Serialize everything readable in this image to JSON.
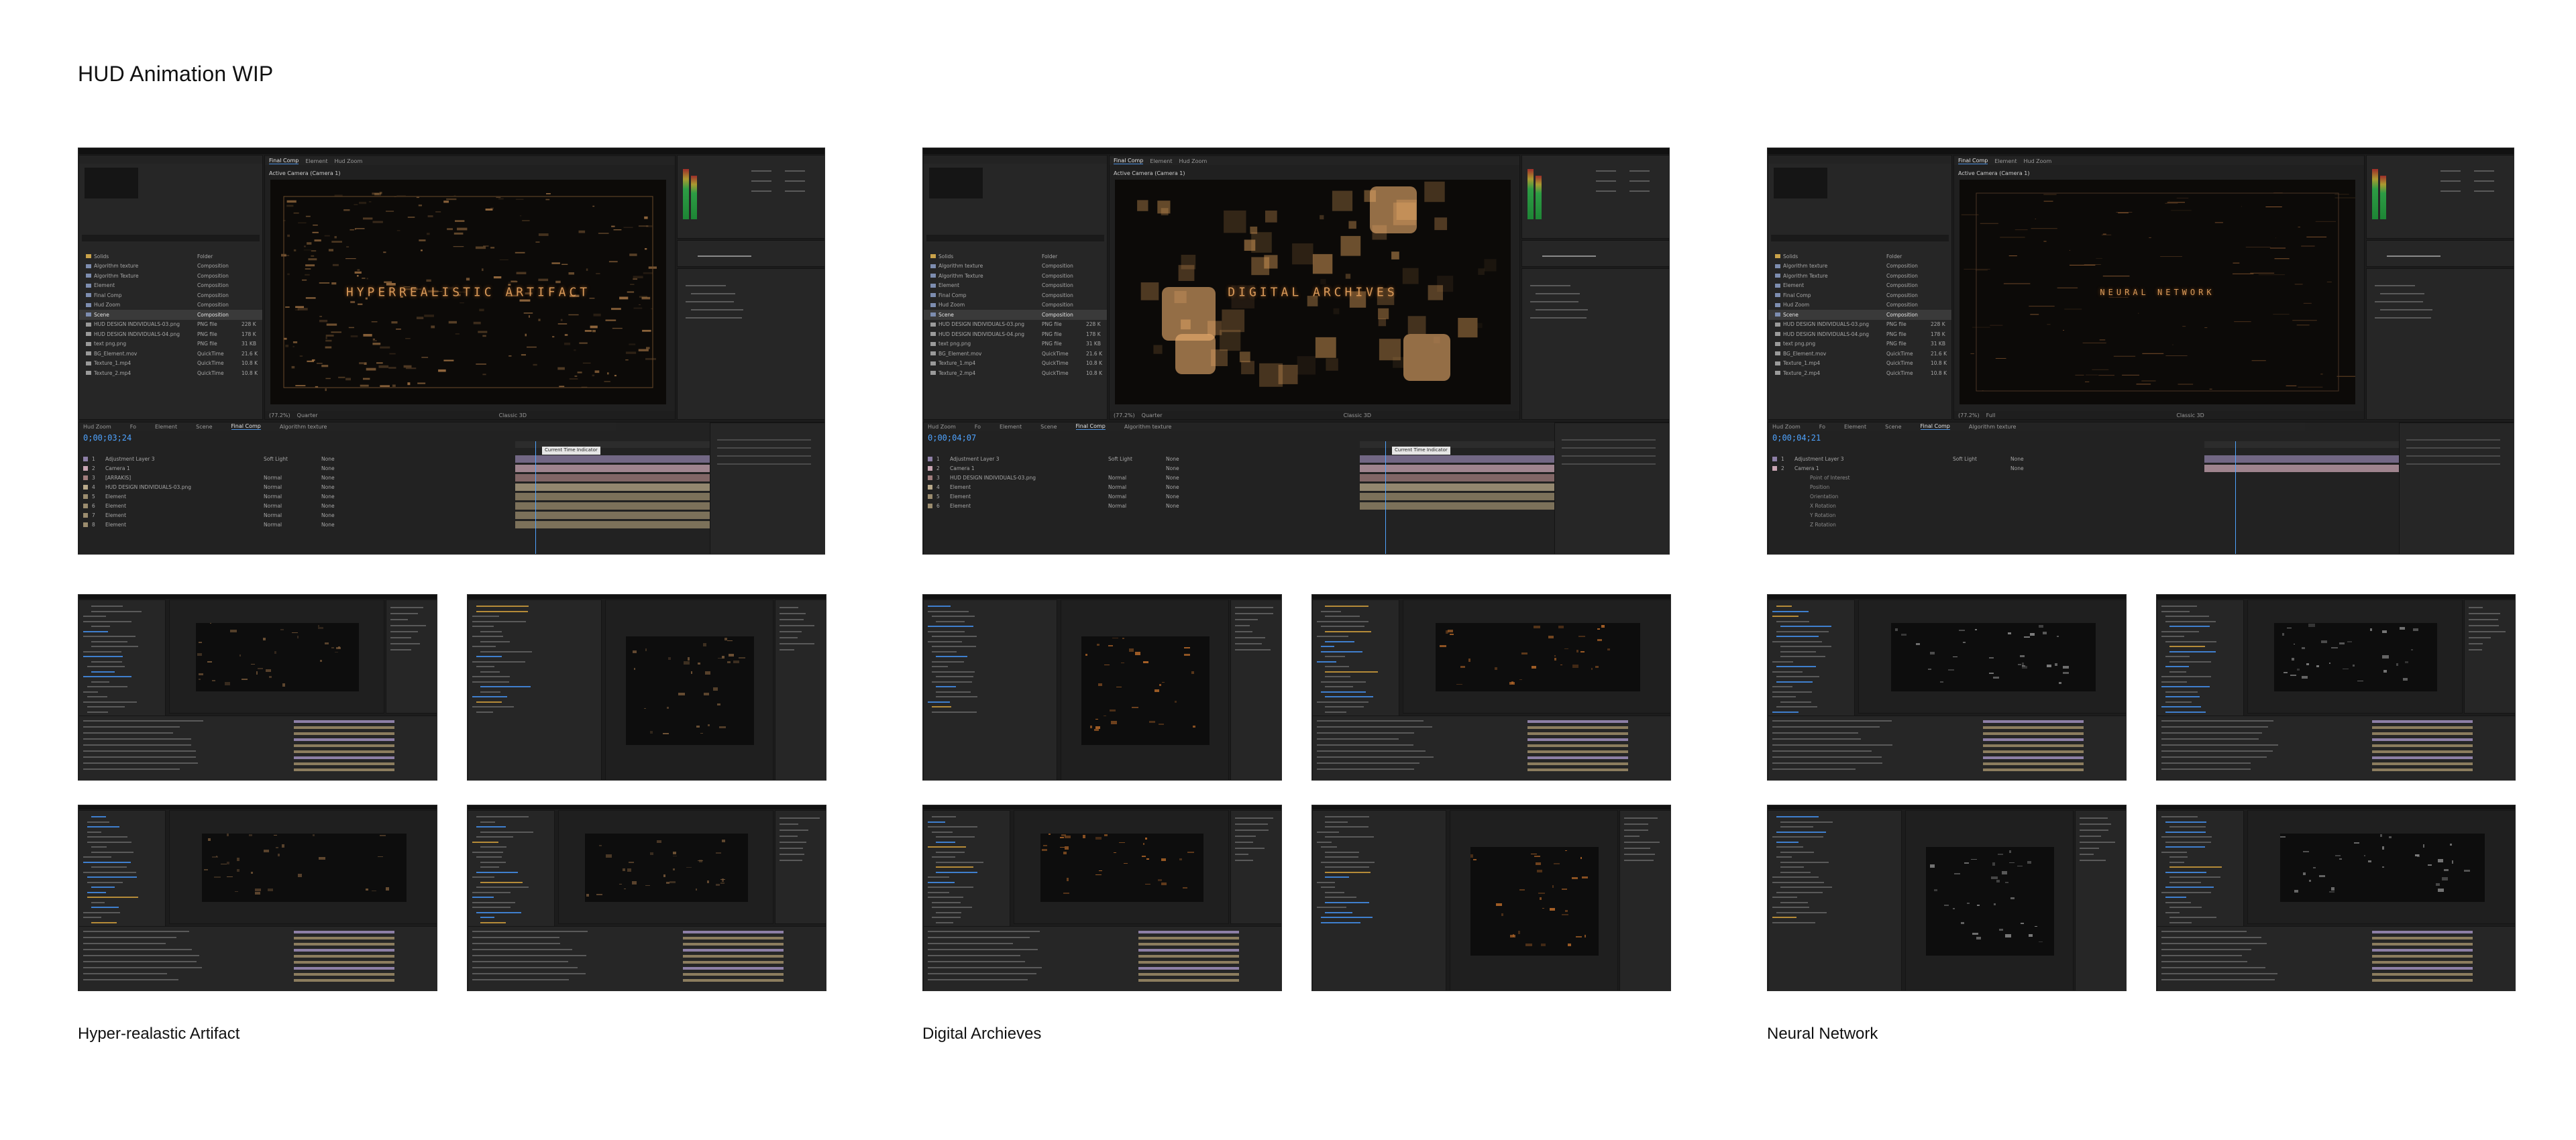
{
  "page": {
    "title": "HUD Animation WIP"
  },
  "projects": [
    {
      "caption": "Hyper-realastic Artifact",
      "composition_tabs": [
        "Final Comp",
        "Element",
        "Hud Zoom"
      ],
      "viewer_label": "Active Camera (Camera 1)",
      "comp_title": "HYPERREALISTIC ARTIFACT",
      "timecode": "0;00;03;24",
      "zoom": "(77.2%)",
      "resolution": "Quarter",
      "renderer": "Classic 3D",
      "project_items": [
        {
          "name": "Solids",
          "type": "Folder",
          "size": ""
        },
        {
          "name": "Algorithm texture",
          "type": "Composition",
          "size": ""
        },
        {
          "name": "Algorithm Texture",
          "type": "Composition",
          "size": ""
        },
        {
          "name": "Element",
          "type": "Composition",
          "size": ""
        },
        {
          "name": "Final Comp",
          "type": "Composition",
          "size": ""
        },
        {
          "name": "Hud Zoom",
          "type": "Composition",
          "size": ""
        },
        {
          "name": "Scene",
          "type": "Composition",
          "size": ""
        },
        {
          "name": "HUD DESIGN INDIVIDUALS-03.png",
          "type": "PNG file",
          "size": "228 K"
        },
        {
          "name": "HUD DESIGN INDIVIDUALS-04.png",
          "type": "PNG file",
          "size": "178 K"
        },
        {
          "name": "text png.png",
          "type": "PNG file",
          "size": "31 KB"
        },
        {
          "name": "BG_Element.mov",
          "type": "QuickTime",
          "size": "21.6 K"
        },
        {
          "name": "Texture_1.mp4",
          "type": "QuickTime",
          "size": "10.8 K"
        },
        {
          "name": "Texture_2.mp4",
          "type": "QuickTime",
          "size": "10.8 K"
        }
      ],
      "timeline_tabs": [
        "Hud Zoom",
        "Fo",
        "Element",
        "Scene",
        "Final Comp",
        "Algorithm texture"
      ],
      "layers": [
        {
          "num": "1",
          "name": "Adjustment Layer 3",
          "mode": "Soft Light",
          "parent": "None"
        },
        {
          "num": "2",
          "name": "Camera 1",
          "mode": "",
          "parent": "None"
        },
        {
          "num": "3",
          "name": "[ARRAKIS]",
          "mode": "Normal",
          "parent": "None"
        },
        {
          "num": "4",
          "name": "HUD DESIGN INDIVIDUALS-03.png",
          "mode": "Normal",
          "parent": "None"
        },
        {
          "num": "5",
          "name": "Element",
          "mode": "Normal",
          "parent": "None"
        },
        {
          "num": "6",
          "name": "Element",
          "mode": "Normal",
          "parent": "None"
        },
        {
          "num": "7",
          "name": "Element",
          "mode": "Normal",
          "parent": "None"
        },
        {
          "num": "8",
          "name": "Element",
          "mode": "Normal",
          "parent": "None"
        }
      ],
      "cti_label": "Current Time Indicator",
      "accent": "#d99a5a"
    },
    {
      "caption": "Digital Archieves",
      "composition_tabs": [
        "Final Comp",
        "Element",
        "Hud Zoom"
      ],
      "viewer_label": "Active Camera (Camera 1)",
      "comp_title": "DIGITAL ARCHIVES",
      "timecode": "0;00;04;07",
      "zoom": "(77.2%)",
      "resolution": "Quarter",
      "renderer": "Classic 3D",
      "project_items": [
        {
          "name": "Solids",
          "type": "Folder",
          "size": ""
        },
        {
          "name": "Algorithm texture",
          "type": "Composition",
          "size": ""
        },
        {
          "name": "Algorithm Texture",
          "type": "Composition",
          "size": ""
        },
        {
          "name": "Element",
          "type": "Composition",
          "size": ""
        },
        {
          "name": "Final Comp",
          "type": "Composition",
          "size": ""
        },
        {
          "name": "Hud Zoom",
          "type": "Composition",
          "size": ""
        },
        {
          "name": "Scene",
          "type": "Composition",
          "size": ""
        },
        {
          "name": "HUD DESIGN INDIVIDUALS-03.png",
          "type": "PNG file",
          "size": "228 K"
        },
        {
          "name": "HUD DESIGN INDIVIDUALS-04.png",
          "type": "PNG file",
          "size": "178 K"
        },
        {
          "name": "text png.png",
          "type": "PNG file",
          "size": "31 KB"
        },
        {
          "name": "BG_Element.mov",
          "type": "QuickTime",
          "size": "21.6 K"
        },
        {
          "name": "Texture_1.mp4",
          "type": "QuickTime",
          "size": "10.8 K"
        },
        {
          "name": "Texture_2.mp4",
          "type": "QuickTime",
          "size": "10.8 K"
        }
      ],
      "timeline_tabs": [
        "Hud Zoom",
        "Fo",
        "Element",
        "Scene",
        "Final Comp",
        "Algorithm texture"
      ],
      "layers": [
        {
          "num": "1",
          "name": "Adjustment Layer 3",
          "mode": "Soft Light",
          "parent": "None"
        },
        {
          "num": "2",
          "name": "Camera 1",
          "mode": "",
          "parent": "None"
        },
        {
          "num": "3",
          "name": "HUD DESIGN INDIVIDUALS-03.png",
          "mode": "Normal",
          "parent": "None"
        },
        {
          "num": "4",
          "name": "Element",
          "mode": "Normal",
          "parent": "None"
        },
        {
          "num": "5",
          "name": "Element",
          "mode": "Normal",
          "parent": "None"
        },
        {
          "num": "6",
          "name": "Element",
          "mode": "Normal",
          "parent": "None"
        }
      ],
      "cti_label": "Current Time Indicator",
      "accent": "#e8a860"
    },
    {
      "caption": "Neural Network",
      "composition_tabs": [
        "Final Comp",
        "Element",
        "Hud Zoom"
      ],
      "viewer_label": "Active Camera (Camera 1)",
      "comp_title": "NEURAL NETWORK",
      "timecode": "0;00;04;21",
      "zoom": "(77.2%)",
      "resolution": "Full",
      "renderer": "Classic 3D",
      "project_items": [
        {
          "name": "Solids",
          "type": "Folder",
          "size": ""
        },
        {
          "name": "Algorithm texture",
          "type": "Composition",
          "size": ""
        },
        {
          "name": "Algorithm Texture",
          "type": "Composition",
          "size": ""
        },
        {
          "name": "Element",
          "type": "Composition",
          "size": ""
        },
        {
          "name": "Final Comp",
          "type": "Composition",
          "size": ""
        },
        {
          "name": "Hud Zoom",
          "type": "Composition",
          "size": ""
        },
        {
          "name": "Scene",
          "type": "Composition",
          "size": ""
        },
        {
          "name": "HUD DESIGN INDIVIDUALS-03.png",
          "type": "PNG file",
          "size": "228 K"
        },
        {
          "name": "HUD DESIGN INDIVIDUALS-04.png",
          "type": "PNG file",
          "size": "178 K"
        },
        {
          "name": "text png.png",
          "type": "PNG file",
          "size": "31 KB"
        },
        {
          "name": "BG_Element.mov",
          "type": "QuickTime",
          "size": "21.6 K"
        },
        {
          "name": "Texture_1.mp4",
          "type": "QuickTime",
          "size": "10.8 K"
        },
        {
          "name": "Texture_2.mp4",
          "type": "QuickTime",
          "size": "10.8 K"
        }
      ],
      "timeline_tabs": [
        "Hud Zoom",
        "Fo",
        "Element",
        "Scene",
        "Final Comp",
        "Algorithm texture"
      ],
      "layers": [
        {
          "num": "1",
          "name": "Adjustment Layer 3",
          "mode": "Soft Light",
          "parent": "None"
        },
        {
          "num": "2",
          "name": "Camera 1",
          "mode": "",
          "parent": "None"
        },
        {
          "num": "",
          "name": "Point of Interest",
          "mode": "",
          "parent": ""
        },
        {
          "num": "",
          "name": "Position",
          "mode": "",
          "parent": ""
        },
        {
          "num": "",
          "name": "Orientation",
          "mode": "",
          "parent": ""
        },
        {
          "num": "",
          "name": "X Rotation",
          "mode": "",
          "parent": ""
        },
        {
          "num": "",
          "name": "Y Rotation",
          "mode": "",
          "parent": ""
        },
        {
          "num": "",
          "name": "Z Rotation",
          "mode": "",
          "parent": ""
        }
      ],
      "cti_label": "",
      "accent": "#d98a4a"
    }
  ]
}
